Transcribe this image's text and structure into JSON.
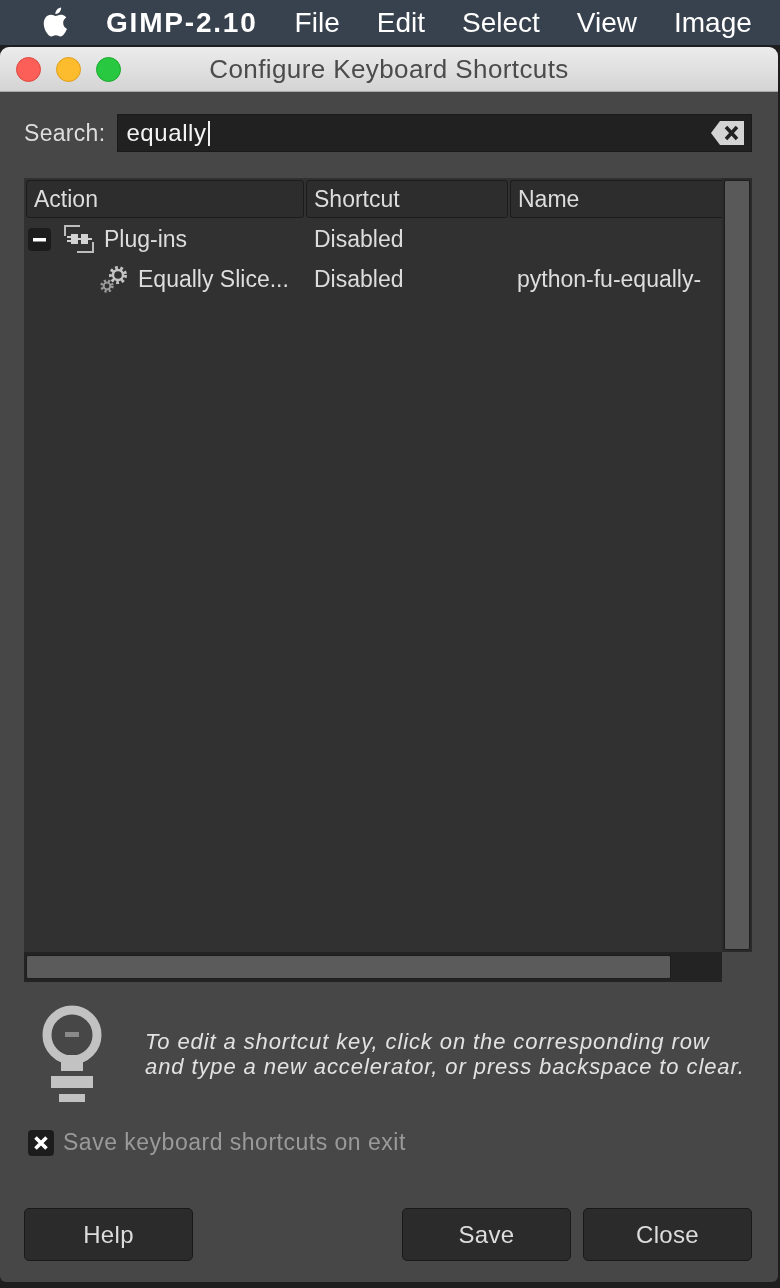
{
  "menu_bar": {
    "app_name": "GIMP-2.10",
    "items": [
      "File",
      "Edit",
      "Select",
      "View",
      "Image"
    ]
  },
  "window": {
    "title": "Configure Keyboard Shortcuts"
  },
  "search": {
    "label": "Search:",
    "value": "equally"
  },
  "table": {
    "columns": [
      "Action",
      "Shortcut",
      "Name"
    ],
    "rows": [
      {
        "kind": "category",
        "action": "Plug-ins",
        "shortcut": "Disabled",
        "expanded": true,
        "children": [
          {
            "kind": "action",
            "action": "Equally Slice...",
            "shortcut": "Disabled",
            "name": "python-fu-equally-"
          }
        ]
      }
    ]
  },
  "hint": "To edit a shortcut key, click on the corresponding row and type a new accelerator, or press backspace to clear.",
  "save_on_exit": {
    "label": "Save keyboard shortcuts on exit",
    "checked": true
  },
  "buttons": [
    "Help",
    "Save",
    "Close"
  ]
}
